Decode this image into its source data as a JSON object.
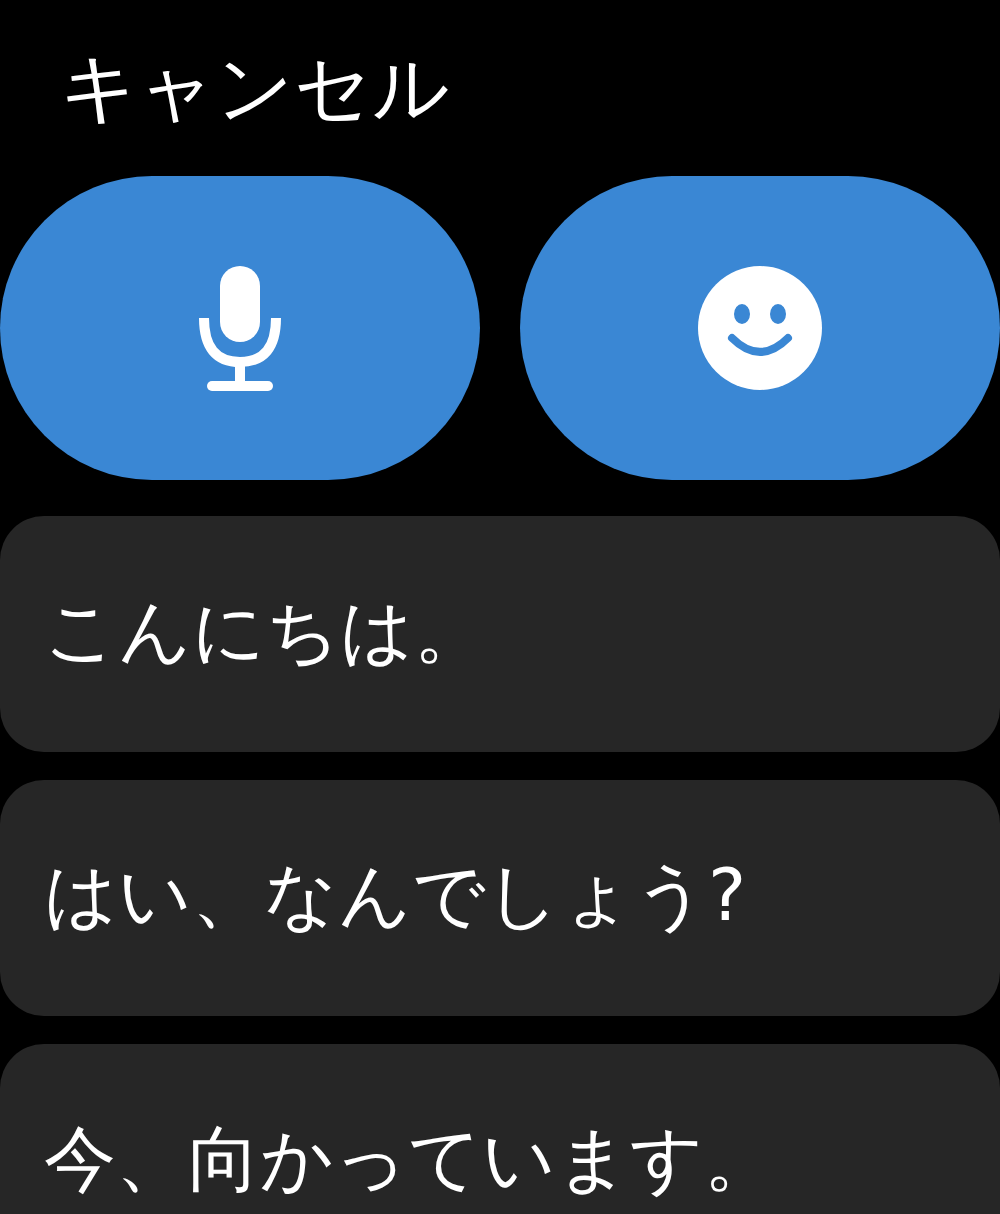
{
  "cancel": "キャンセル",
  "input_buttons": [
    {
      "kind": "microphone"
    },
    {
      "kind": "emoji"
    }
  ],
  "replies": [
    "こんにちは。",
    "はい、なんでしょう?",
    "今、向かっています。"
  ]
}
